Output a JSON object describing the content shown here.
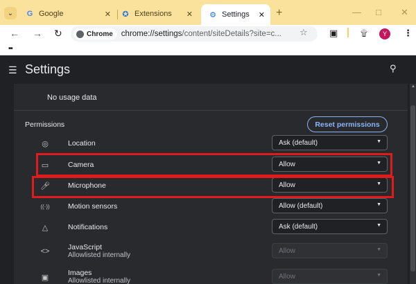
{
  "browser": {
    "tabs": [
      {
        "title": "Google",
        "favicon": "google-icon",
        "active": false
      },
      {
        "title": "Extensions",
        "favicon": "puzzle-icon",
        "active": false
      },
      {
        "title": "Settings",
        "favicon": "gear-icon",
        "active": true
      }
    ],
    "omnibox": {
      "chip": "Chrome",
      "url_host": "chrome://settings",
      "url_path": "/content/siteDetails?site=c..."
    },
    "profile_initial": "Y"
  },
  "settings": {
    "title": "Settings",
    "usage_text": "No usage data",
    "permissions_heading": "Permissions",
    "reset_label": "Reset permissions",
    "rows": [
      {
        "label": "Location",
        "sublabel": "",
        "value": "Ask (default)",
        "icon": "location-icon",
        "enabled": true
      },
      {
        "label": "Camera",
        "sublabel": "",
        "value": "Allow",
        "icon": "camera-icon",
        "enabled": true
      },
      {
        "label": "Microphone",
        "sublabel": "",
        "value": "Allow",
        "icon": "microphone-icon",
        "enabled": true
      },
      {
        "label": "Motion sensors",
        "sublabel": "",
        "value": "Allow (default)",
        "icon": "motion-sensors-icon",
        "enabled": true
      },
      {
        "label": "Notifications",
        "sublabel": "",
        "value": "Ask (default)",
        "icon": "bell-icon",
        "enabled": true
      },
      {
        "label": "JavaScript",
        "sublabel": "Allowlisted internally",
        "value": "Allow",
        "icon": "code-icon",
        "enabled": false
      },
      {
        "label": "Images",
        "sublabel": "Allowlisted internally",
        "value": "Allow",
        "icon": "image-icon",
        "enabled": false
      }
    ]
  },
  "colors": {
    "tabstrip": "#fbe29c",
    "accent": "#8ab4f8",
    "highlight": "#e01b1b",
    "card": "#292a2d"
  }
}
